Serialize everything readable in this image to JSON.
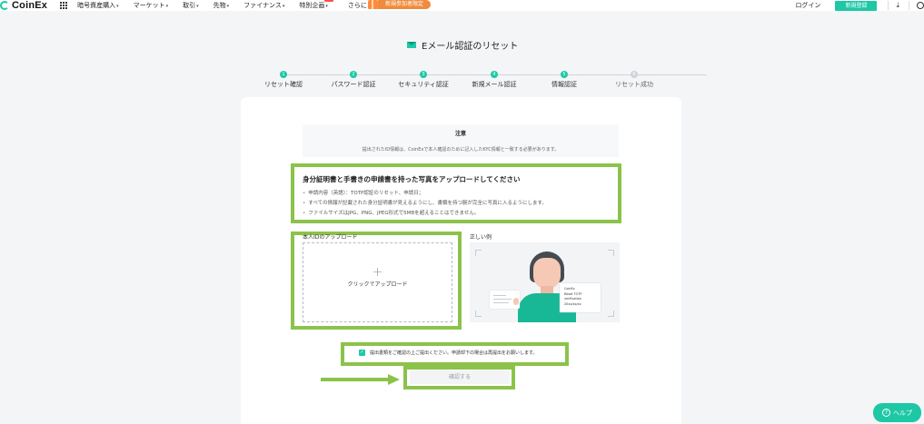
{
  "header": {
    "logo_text": "CoinEx",
    "nav": [
      {
        "label": "暗号資産購入"
      },
      {
        "label": "マーケット"
      },
      {
        "label": "取引"
      },
      {
        "label": "先物"
      },
      {
        "label": "ファイナンス"
      },
      {
        "label": "特別企画"
      },
      {
        "label": "さらに"
      }
    ],
    "promo_label": "新規参加者限定",
    "login_label": "ログイン",
    "signup_label": "新規登録"
  },
  "page": {
    "title": "Eメール認証のリセット"
  },
  "stepper": {
    "steps": [
      {
        "num": "1",
        "label": "リセット確認",
        "done": true
      },
      {
        "num": "2",
        "label": "パスワード認証",
        "done": true
      },
      {
        "num": "3",
        "label": "セキュリティ認証",
        "done": true
      },
      {
        "num": "4",
        "label": "新規メール認証",
        "done": true
      },
      {
        "num": "5",
        "label": "情報認証",
        "done": true
      },
      {
        "num": "6",
        "label": "リセット成功",
        "done": false
      }
    ]
  },
  "notice": {
    "title": "注意",
    "text": "提出されたID情報は、CoinExで本人確認のために記入したKYC情報と一致する必要があります。"
  },
  "requirements": {
    "title": "身分証明書と手書きの申請書を持った写真をアップロードしてください",
    "items": [
      "申請内容（英語）：TOTP認証のリセット、申請日；",
      "すべての情報が記載された身分証明書が見えるようにし、書類を持つ腕が完全に写真に入るようにします。",
      "ファイルサイズはJPG、PNG、JPEG形式で5MBを超えることはできません。"
    ]
  },
  "upload": {
    "label": "本人IDのアップロード",
    "text": "クリックでアップロード"
  },
  "example": {
    "label": "正しい例",
    "paper_lines": [
      "CoinEx",
      "Reset TOTP",
      "verification",
      "20xx/xx/xx"
    ]
  },
  "agreement": {
    "checked": true,
    "text": "提出書類をご確認の上ご提出ください。申請却下の場合は再提出をお願いします。"
  },
  "confirm_label": "確認する",
  "help_label": "ヘルプ",
  "colors": {
    "accent": "#1ec8a5",
    "highlight": "#8bc34a",
    "promo": "#f08a3c"
  }
}
